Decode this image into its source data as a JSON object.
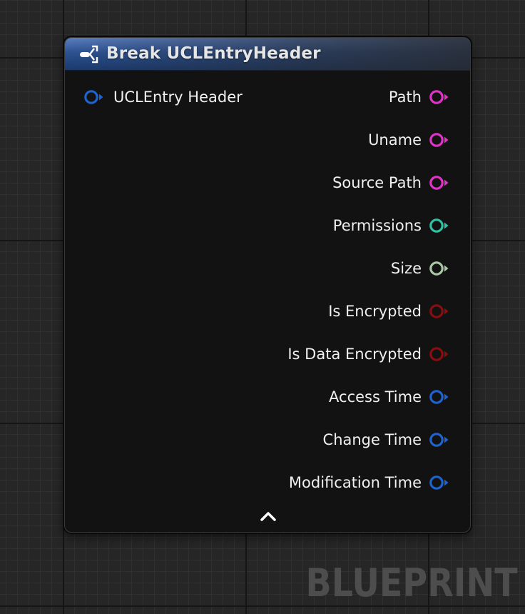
{
  "node": {
    "title": "Break UCLEntryHeader",
    "icon": "break-struct-icon",
    "header_color": "#2c5292",
    "input_pin": {
      "label": "UCLEntry Header",
      "color": "#1e63d0"
    },
    "output_pins": [
      {
        "label": "Path",
        "color": "#e233c8"
      },
      {
        "label": "Uname",
        "color": "#e233c8"
      },
      {
        "label": "Source Path",
        "color": "#e233c8"
      },
      {
        "label": "Permissions",
        "color": "#2fc2a4"
      },
      {
        "label": "Size",
        "color": "#a8c9a4"
      },
      {
        "label": "Is Encrypted",
        "color": "#8a0e0e"
      },
      {
        "label": "Is Data Encrypted",
        "color": "#8a0e0e"
      },
      {
        "label": "Access Time",
        "color": "#1e63d0"
      },
      {
        "label": "Change Time",
        "color": "#1e63d0"
      },
      {
        "label": "Modification Time",
        "color": "#1e63d0"
      }
    ],
    "collapse_icon": "chevron-up-icon"
  },
  "watermark": "BLUEPRINT"
}
